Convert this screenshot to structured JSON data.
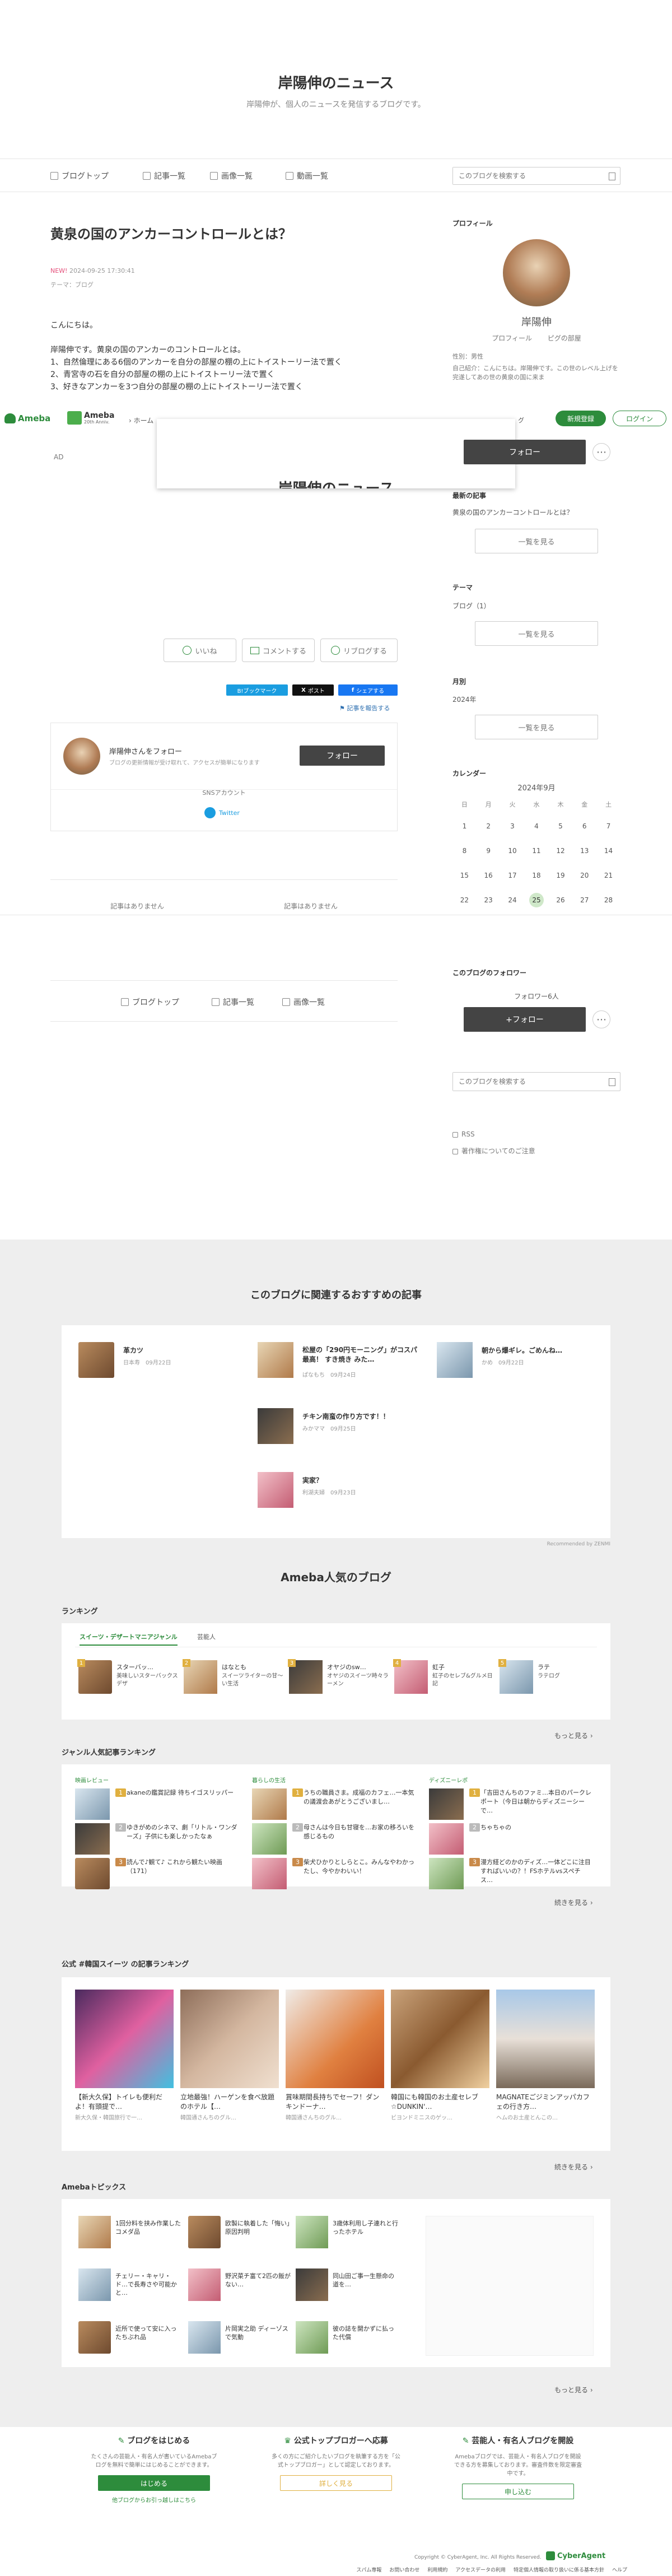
{
  "blog": {
    "title": "岸陽伸のニュース",
    "subtitle": "岸陽伸が、個人のニュースを発信するブログです。"
  },
  "nav": {
    "items": [
      "ブログトップ",
      "記事一覧",
      "画像一覧",
      "動画一覧"
    ],
    "search_placeholder": "このブログを検索する"
  },
  "article": {
    "title": "黄泉の国のアンカーコントロールとは？",
    "new_label": "NEW!",
    "date": "2024-09-25 17:30:41",
    "theme": "テーマ：ブログ",
    "body": [
      "こんにちは。",
      "岸陽伸です。黄泉の国のアンカーのコントロールとは。",
      "1、自然倫理にある6個のアンカーを自分の部屋の棚の上にトイストーリー法で置く",
      "2、青宮寺の石を自分の部屋の棚の上にトイストーリー法で置く",
      "3、好きなアンカーを3つ自分の部屋の棚の上にトイストーリー法で置く"
    ],
    "ad_label": "AD",
    "like": "いいね",
    "comment": "コメントする",
    "reblog": "リブログする",
    "share": [
      "B!ブックマーク",
      "ポスト",
      "シェアする"
    ],
    "report": "記事を報告する"
  },
  "overlay": {
    "brand": "Ameba",
    "brand_sub": "20th Anniv.",
    "home": "ホーム",
    "login_hint": "ログイン",
    "register": "新規登録",
    "login": "ログイン",
    "follow": "フォロー",
    "overlay_title": "岸陽伸のニュース"
  },
  "follow_card": {
    "name": "岸陽伸さんをフォロー",
    "desc": "ブログの更新情報が受け取れて、アクセスが簡単になります",
    "follow_btn": "フォロー",
    "sns_title": "SNSアカウント",
    "twitter": "Twitter"
  },
  "prev_next": [
    "記事はありません",
    "記事はありません"
  ],
  "bottom_nav": [
    "ブログトップ",
    "記事一覧",
    "画像一覧"
  ],
  "sidebar": {
    "profile_title": "プロフィール",
    "name": "岸陽伸",
    "profile_link": "プロフィール",
    "pigg_link": "ピグの部屋",
    "gender": "性別：男性",
    "intro": "自己紹介：こんにちは。岸陽伸です。この世のレベル上げを完遂してあの世の黄泉の国に来ま",
    "follow_btn": "フォロー",
    "recent_title": "最新の記事",
    "recent_item": "黄泉の国のアンカーコントロールとは？",
    "list_btn": "一覧を見る",
    "theme_title": "テーマ",
    "theme_item": "ブログ（1）",
    "month_title": "月別",
    "month_item": "2024年",
    "calendar_title": "カレンダー",
    "calendar_month": "2024年9月",
    "weekdays": [
      "日",
      "月",
      "火",
      "水",
      "木",
      "金",
      "土"
    ],
    "weeks": [
      [
        "1",
        "2",
        "3",
        "4",
        "5",
        "6",
        "7"
      ],
      [
        "8",
        "9",
        "10",
        "11",
        "12",
        "13",
        "14"
      ],
      [
        "15",
        "16",
        "17",
        "18",
        "19",
        "20",
        "21"
      ],
      [
        "22",
        "23",
        "24",
        "25",
        "26",
        "27",
        "28"
      ]
    ],
    "follow_section_title": "このブログのフォロワー",
    "follower_count": "フォロワー6人",
    "follow_plus": "+フォロー",
    "search_placeholder": "このブログを検索する",
    "rss": "RSS",
    "copyright_note": "著作権についてのご注意"
  },
  "recommend": {
    "title": "このブログに関連するおすすめの記事",
    "items": [
      {
        "title": "革カツ",
        "meta": "日本寿　09月22日"
      },
      {
        "title": "松屋の「290円モーニング」がコスパ最高！ すき焼き みた…",
        "meta": "ぱなもち　09月24日"
      },
      {
        "title": "朝から爆ギレ。ごめんね…",
        "meta": "かめ　09月22日"
      },
      {
        "title": "チキン南蛮の作り方です！！",
        "meta": "みかママ　09月25日"
      },
      {
        "title": "実家？",
        "meta": "利湖夫婦　09月23日"
      }
    ],
    "credit": "Recommended by ZENMI"
  },
  "popular": {
    "title": "Ameba人気のブログ",
    "ranking_title": "ランキング",
    "tabs": [
      "スイーツ・デザートマニアジャンル",
      "芸能人"
    ],
    "ranking": [
      {
        "rank": "1",
        "name": "スターバッ…",
        "desc": "美味しいスターバックスデザ"
      },
      {
        "rank": "2",
        "name": "はなとも",
        "desc": "スイーツライターの甘〜い生活"
      },
      {
        "rank": "3",
        "name": "オヤジのsw…",
        "desc": "オヤジのスイーツ時々ラーメン"
      },
      {
        "rank": "4",
        "name": "虹子",
        "desc": "虹子のセレブ&グルメ日記"
      },
      {
        "rank": "5",
        "name": "ラテ",
        "desc": "ラテログ"
      }
    ],
    "more": "もっと見る",
    "genre_title": "ジャンル人気記事ランキング",
    "genre_cols": [
      {
        "label": "映画レビュー",
        "items": [
          {
            "rank": "1",
            "text": "akaneの鑑賞記録 待ちイゴスリッパー"
          },
          {
            "rank": "2",
            "text": "ゆきがめのシネマ、劇「リトル・ワンダーズ」子供にも楽しかったなぁ"
          },
          {
            "rank": "3",
            "text": "読んで♪観て♪ これから観たい映画（171）"
          }
        ]
      },
      {
        "label": "暮らしの生活",
        "items": [
          {
            "rank": "1",
            "text": "うちの職員さま。成福のカフェ…一本気の議渡会あがとうございまし…"
          },
          {
            "rank": "2",
            "text": "母さんは今日も甘寝を…お家の移ろいを感じるもの"
          },
          {
            "rank": "3",
            "text": "柴犬ひかりとしらとこ。みんなやわかったし、今やかわいい！"
          }
        ]
      },
      {
        "label": "ディズニーレポ",
        "items": [
          {
            "rank": "1",
            "text": "「吉田さんちのファミ…本日のパークレポート（今日は朝からディズニーシーで…"
          },
          {
            "rank": "2",
            "text": "ちゃちゃの"
          },
          {
            "rank": "3",
            "text": "漫方経どのかのディズ…一体どこに注目すればいいの？！FSホテルvsスペチス…"
          }
        ]
      }
    ],
    "genre_more": "続きを見る",
    "sweets_title": "公式 #韓国スイーツ の記事ランキング",
    "sweets": [
      {
        "text": "【新大久保】トイレも便利だよ！有頭提で…",
        "meta": "新大久保・韓国旅行で一…"
      },
      {
        "text": "立地最強！ハーゲンを食べ放題のホテル【…",
        "meta": "韓国通さんちのグル…"
      },
      {
        "text": "賞味期間長持ちでセーフ！ダンキンドーナ…",
        "meta": "韓国通さんちのグル…"
      },
      {
        "text": "韓国にも韓国のお土産セレブ☆DUNKIN'…",
        "meta": "ビヨンドミニスのゲッ…"
      },
      {
        "text": "MAGNATEごジミンアッパカフェの行き方…",
        "meta": "ヘムのお土産とんこの…"
      }
    ],
    "sweets_more": "続きを見る",
    "topics_title": "Amebaトピックス",
    "topics": [
      "1回分料を挟み作業したコメダ品",
      "欧製に執着した「悔い」原因判明",
      "3歳体利用し子連れと行ったホテル",
      "チェリー・キャリ・ド…で長寿さや可能かと…",
      "野沢菜チ富て2匹の飯がない…",
      "同山田ご事一生懸命の道を…",
      "近所で使って安に入ったちぶれ品",
      "片岡実之助 ディーゾスで気動",
      "彼の誌を開かずに払った代償"
    ],
    "topics_more": "もっと見る"
  },
  "footer": {
    "cols": [
      {
        "title": "ブログをはじめる",
        "desc": "たくさんの芸能人・有名人が書いているAmebaブログを無料で簡単にはじめることができます。",
        "btn": "はじめる",
        "link": "他ブログからお引っ越しはこちら"
      },
      {
        "title": "公式トップブロガーへ応募",
        "desc": "多くの方にご紹介したいブログを執筆する方を「公式トップブロガー」として認定しております。",
        "btn": "詳しく見る"
      },
      {
        "title": "芸能人・有名人ブログを開設",
        "desc": "Amebaブログでは、芸能人・有名人ブログを開設できる方を募集しております。審査件数を限定審査中です。",
        "btn": "申し込む"
      }
    ],
    "copyright": "Copyright © CyberAgent, Inc. All Rights Reserved.",
    "company": "CyberAgent",
    "links": [
      "スパム専報",
      "お問い合わせ",
      "利用規約",
      "アクセスデータの利用",
      "特定個人情報の取り扱いに係る基本方針",
      "ヘルプ"
    ]
  },
  "colors": {
    "ameba_green": "#2d8c3c",
    "accent_pink": "#e44e7a",
    "dark_btn": "#444444",
    "bg_gray": "#eeeeee"
  }
}
